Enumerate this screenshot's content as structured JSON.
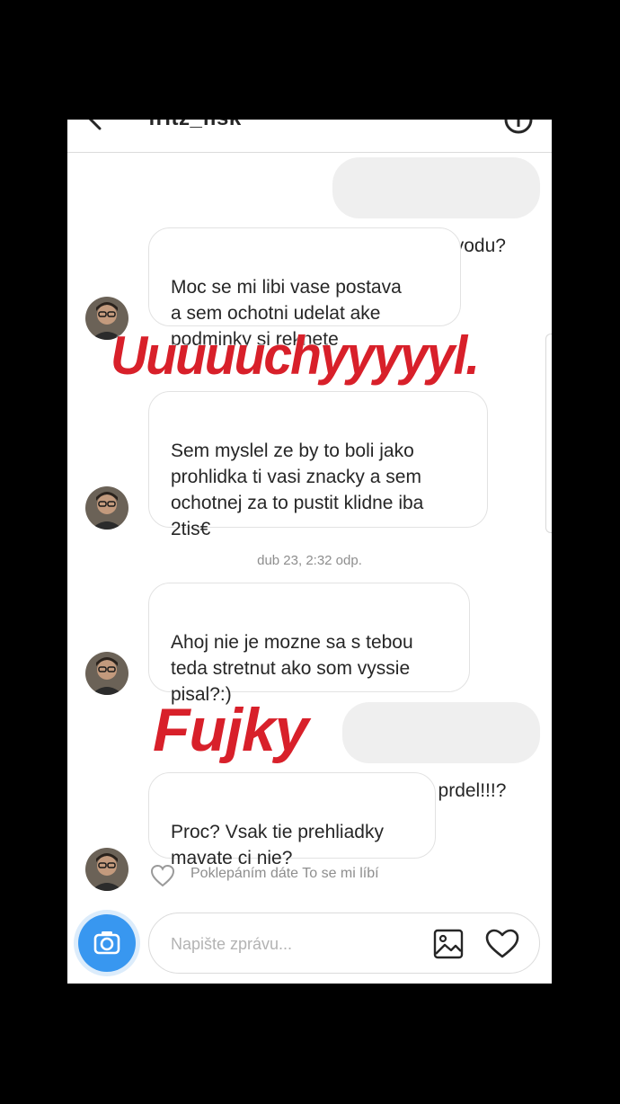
{
  "header": {
    "title": "fritz_fisk"
  },
  "messages": {
    "m1": "Z jakeho duvodu?",
    "m2": "Moc se mi libi vase postava\na sem ochotni udelat ake\npodminky si reknete",
    "m3": "Sem myslel ze by to boli jako\nprohlidka ti vasi znacky a sem\nochotnej za to pustit klidne iba\n2tis€",
    "timestamp": "dub 23, 2:32 odp.",
    "m4": "Ahoj nie je mozne sa s tebou\nteda stretnut ako som vyssie\npisal?:)",
    "m5": "Delas si prdel!!!?",
    "m6": "Proc? Vsak tie prehliadky\nmavate ci nie?"
  },
  "stickers": {
    "s1": "Uuuuuchyyyyyl.",
    "s2": "Fujky"
  },
  "like_hint": "Poklepáním dáte To se mi líbí",
  "composer": {
    "placeholder": "Napište zprávu..."
  },
  "colors": {
    "sticker_red": "#d8202a",
    "camera_blue": "#3897f0"
  },
  "icons": [
    "back-arrow-icon",
    "info-icon",
    "heart-outline-icon",
    "camera-icon",
    "gallery-icon",
    "heart-icon"
  ]
}
